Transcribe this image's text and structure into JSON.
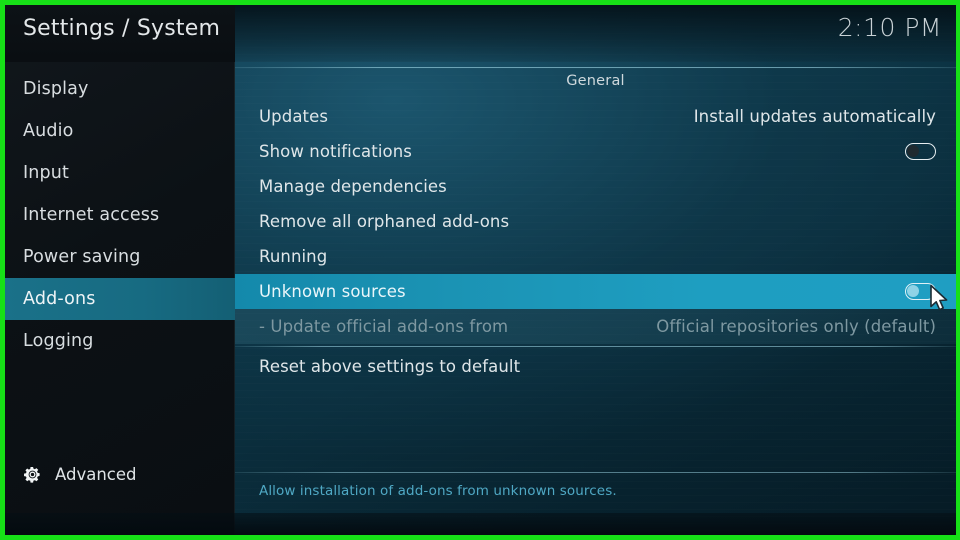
{
  "window": {
    "title": "Settings / System",
    "clock": "2:10 PM",
    "accent_green": "#17e017",
    "highlight_blue": "#1e9ec1",
    "sidebar_highlight": "#1a7189",
    "description_color": "#4fa8c4"
  },
  "sidebar": {
    "items": [
      {
        "label": "Display",
        "selected": false
      },
      {
        "label": "Audio",
        "selected": false
      },
      {
        "label": "Input",
        "selected": false
      },
      {
        "label": "Internet access",
        "selected": false
      },
      {
        "label": "Power saving",
        "selected": false
      },
      {
        "label": "Add-ons",
        "selected": true
      },
      {
        "label": "Logging",
        "selected": false
      }
    ],
    "advanced": {
      "label": "Advanced",
      "icon": "gear-icon"
    }
  },
  "content": {
    "group_label": "General",
    "rows": [
      {
        "label": "Updates",
        "value": "Install updates automatically",
        "type": "value",
        "state": "normal"
      },
      {
        "label": "Show notifications",
        "value": "",
        "type": "toggle",
        "state": "normal",
        "toggle_on": false
      },
      {
        "label": "Manage dependencies",
        "value": "",
        "type": "action",
        "state": "normal"
      },
      {
        "label": "Remove all orphaned add-ons",
        "value": "",
        "type": "action",
        "state": "normal"
      },
      {
        "label": "Running",
        "value": "",
        "type": "action",
        "state": "normal"
      },
      {
        "label": "Unknown sources",
        "value": "",
        "type": "toggle",
        "state": "selected",
        "toggle_on": false
      },
      {
        "label": "- Update official add-ons from",
        "value": "Official repositories only (default)",
        "type": "value",
        "state": "disabled"
      },
      {
        "label": "Reset above settings to default",
        "value": "",
        "type": "action",
        "state": "normal"
      }
    ],
    "description": "Allow installation of add-ons from unknown sources."
  }
}
